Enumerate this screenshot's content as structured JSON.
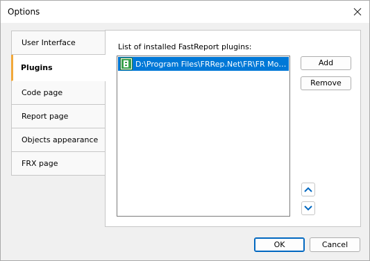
{
  "window": {
    "title": "Options"
  },
  "tabs": [
    {
      "label": "User Interface",
      "selected": false
    },
    {
      "label": "Plugins",
      "selected": true
    },
    {
      "label": "Code page",
      "selected": false
    },
    {
      "label": "Report page",
      "selected": false
    },
    {
      "label": "Objects appearance",
      "selected": false
    },
    {
      "label": "FRX page",
      "selected": false
    }
  ],
  "plugins_panel": {
    "label": "List of installed FastReport plugins:",
    "items": [
      {
        "path": "D:\\Program Files\\FRRep.Net\\FR\\FR Mono...",
        "icon": "plugin-icon",
        "selected": true
      }
    ],
    "add_label": "Add",
    "remove_label": "Remove"
  },
  "footer": {
    "ok_label": "OK",
    "cancel_label": "Cancel"
  },
  "colors": {
    "accent": "#0078d7",
    "tab_marker": "#f1a83a",
    "icon_green": "#3aa14a"
  }
}
